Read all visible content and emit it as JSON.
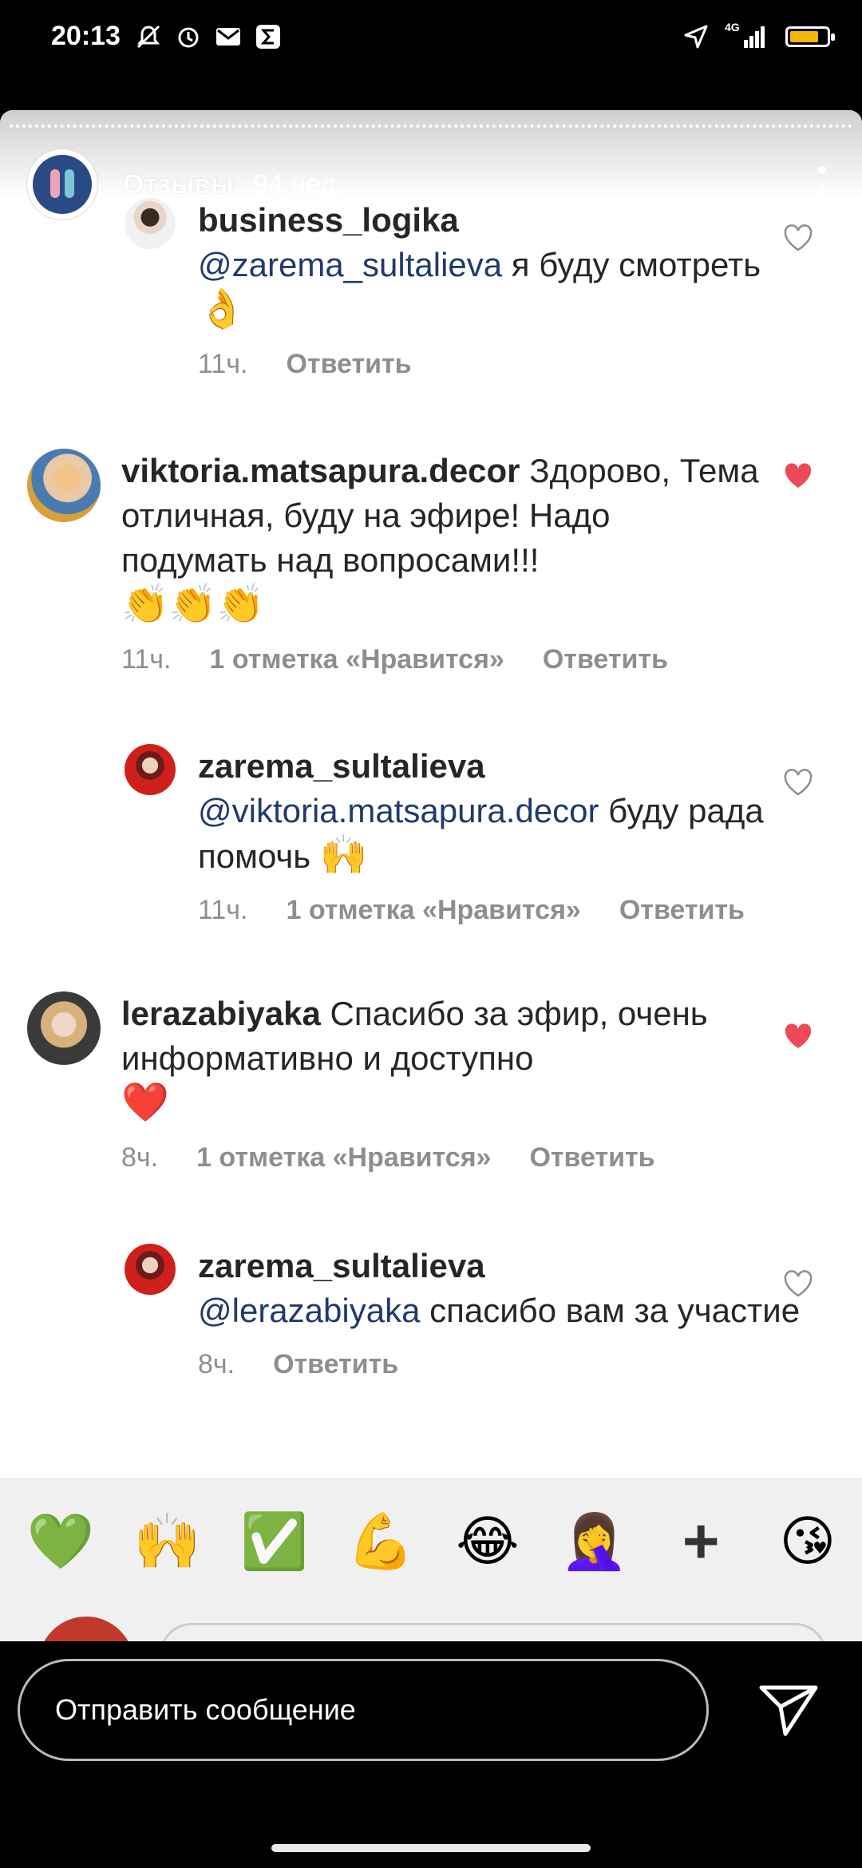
{
  "status_bar": {
    "time": "20:13",
    "network": "4G",
    "battery_percent": 80,
    "icons": [
      "mute-bell-icon",
      "alarm-icon",
      "gmail-icon",
      "sigma-app-icon",
      "location-arrow-icon",
      "signal-icon",
      "battery-icon"
    ]
  },
  "story": {
    "title": "Отзывы",
    "time": "94 нед.",
    "menu_icon": "more-vertical-icon"
  },
  "comments": [
    {
      "user": "business_logika",
      "mention": "@zarema_sultalieva",
      "text": " я буду смотреть ",
      "emoji": "👌",
      "time": "11ч.",
      "likes": "",
      "reply_label": "Ответить",
      "liked": false
    },
    {
      "user": "viktoria.matsapura.decor",
      "mention": "",
      "text": " Здорово, Тема отличная, буду на эфире! Надо подумать над вопросами!!! ",
      "emoji": "👏👏👏",
      "time": "11ч.",
      "likes": "1 отметка «Нравится»",
      "reply_label": "Ответить",
      "liked": true
    },
    {
      "user": "zarema_sultalieva",
      "mention": "@viktoria.matsapura.decor",
      "text": " буду рада помочь ",
      "emoji": "🙌",
      "time": "11ч.",
      "likes": "1 отметка «Нравится»",
      "reply_label": "Ответить",
      "liked": false
    },
    {
      "user": "lerazabiyaka",
      "mention": "",
      "text": " Спасибо за эфир, очень информативно и доступно ",
      "emoji": "❤️",
      "time": "8ч.",
      "likes": "1 отметка «Нравится»",
      "reply_label": "Ответить",
      "liked": true
    },
    {
      "user": "zarema_sultalieva",
      "mention": "@lerazabiyaka",
      "text": " спасибо вам за участие",
      "emoji": "",
      "time": "8ч.",
      "likes": "",
      "reply_label": "Ответить",
      "liked": false
    }
  ],
  "reactions": [
    "💚",
    "🙌",
    "✅",
    "💪",
    "😂",
    "🤦‍♀️",
    "+",
    "😘"
  ],
  "reply_bar": {
    "placeholder": "Отправить сообщение",
    "send_icon": "send-arrow-icon"
  },
  "colors": {
    "heart_liked": "#ed4956",
    "mention": "#1f3a6e",
    "meta": "#8e8e8e"
  }
}
